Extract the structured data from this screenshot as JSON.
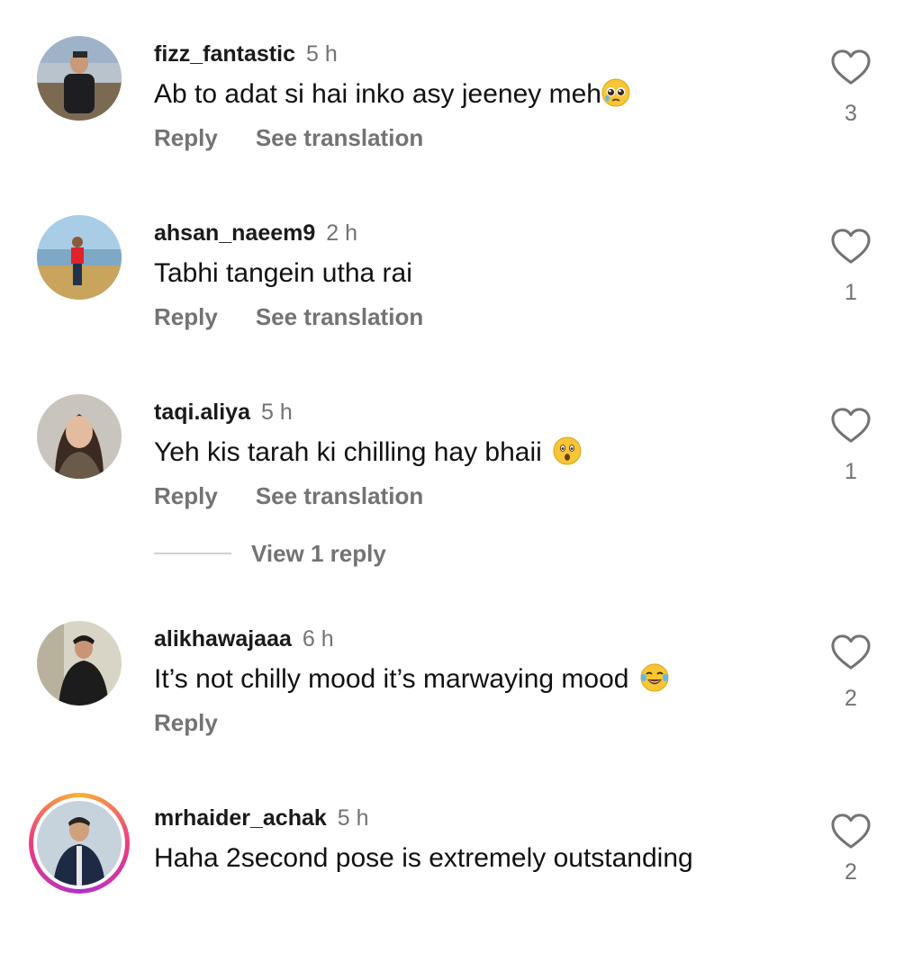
{
  "comments": [
    {
      "username": "fizz_fantastic",
      "time": "5 h",
      "text": "Ab to adat si hai inko asy jeeney meh",
      "emoji": "pleading-face",
      "reply": "Reply",
      "see_translation": "See translation",
      "likes": "3"
    },
    {
      "username": "ahsan_naeem9",
      "time": "2 h",
      "text": "Tabhi tangein utha rai",
      "emoji": "",
      "reply": "Reply",
      "see_translation": "See translation",
      "likes": "1"
    },
    {
      "username": "taqi.aliya",
      "time": "5 h",
      "text": "Yeh kis tarah ki chilling hay bhaii ",
      "emoji": "astonished-face",
      "reply": "Reply",
      "see_translation": "See translation",
      "likes": "1",
      "view_replies": "View 1 reply"
    },
    {
      "username": "alikhawajaaa",
      "time": "6 h",
      "text": "It’s not chilly mood it’s marwaying mood ",
      "emoji": "tears-of-joy-face",
      "reply": "Reply",
      "likes": "2"
    },
    {
      "username": "mrhaider_achak",
      "time": "5 h",
      "text": "Haha 2second pose is extremely outstanding",
      "emoji": "",
      "likes": "2",
      "has_story": true
    }
  ],
  "colors": {
    "text": "#111111",
    "muted": "#737373",
    "divider": "#d0d0d0"
  }
}
